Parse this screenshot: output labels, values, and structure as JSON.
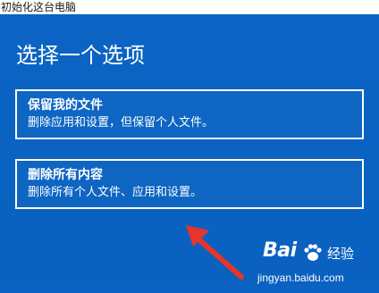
{
  "window": {
    "title": "初始化这台电脑"
  },
  "dialog": {
    "heading": "选择一个选项",
    "options": [
      {
        "title": "保留我的文件",
        "description": "删除应用和设置，但保留个人文件。"
      },
      {
        "title": "删除所有内容",
        "description": "删除所有个人文件、应用和设置。"
      }
    ]
  },
  "annotation": {
    "arrow_color": "#e8342b",
    "arrow_icon": "red-arrow-icon"
  },
  "watermark": {
    "logo_text": "Bai",
    "logo_suffix": "经验",
    "url": "jingyan.baidu.com"
  },
  "colors": {
    "background": "#0a63c3",
    "text": "#ffffff",
    "titlebar": "#ffffff"
  }
}
